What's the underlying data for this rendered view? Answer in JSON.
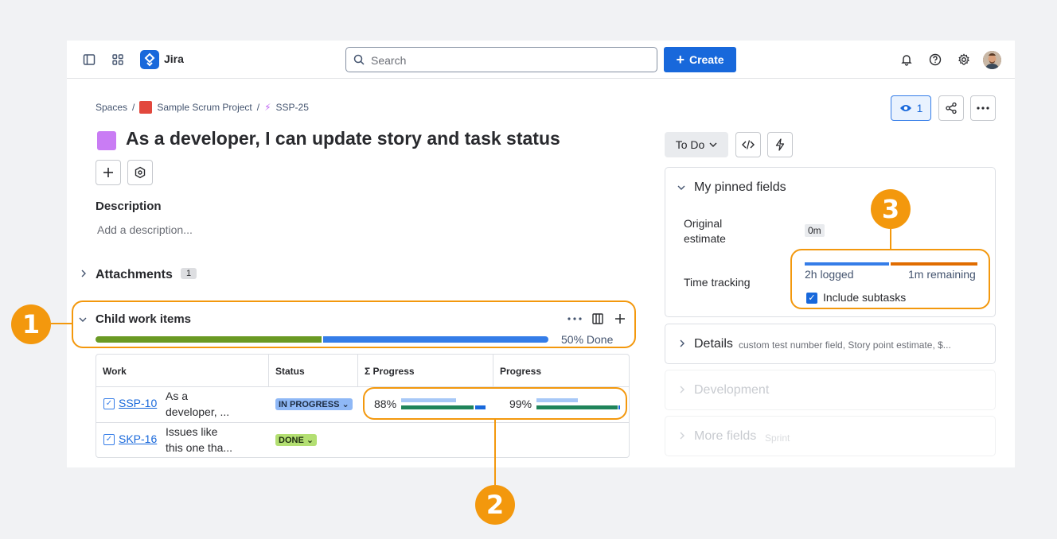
{
  "topbar": {
    "app_name": "Jira",
    "search_placeholder": "Search",
    "create_label": "Create"
  },
  "breadcrumb": {
    "spaces": "Spaces",
    "project": "Sample Scrum Project",
    "issue": "SSP-25"
  },
  "issue": {
    "title": "As a developer, I can update story and task status",
    "description_heading": "Description",
    "description_placeholder": "Add a description...",
    "attachments_heading": "Attachments",
    "attachments_count": "1",
    "child_heading": "Child work items",
    "child_progress_text": "50% Done",
    "child_progress": {
      "done_fraction": 0.5
    }
  },
  "child_table": {
    "headers": [
      "Work",
      "Status",
      "Σ Progress",
      "Progress"
    ],
    "rows": [
      {
        "key": "SSP-10",
        "summary_line1": "As a",
        "summary_line2": "developer, ...",
        "status": "IN PROGRESS",
        "sum_progress": "88%",
        "progress": "99%"
      },
      {
        "key": "SKP-16",
        "summary_line1": "Issues like",
        "summary_line2": "this one tha...",
        "status": "DONE",
        "sum_progress": "",
        "progress": ""
      }
    ]
  },
  "sidebar": {
    "watch_count": "1",
    "status_button": "To Do",
    "pinned_heading": "My pinned fields",
    "original_estimate_label_1": "Original",
    "original_estimate_label_2": "estimate",
    "original_estimate_value": "0m",
    "time_tracking_label": "Time tracking",
    "logged": "2h logged",
    "remaining": "1m remaining",
    "include_subtasks": "Include subtasks",
    "details_heading": "Details",
    "details_sub": "custom test number field, Story point estimate, $...",
    "development_heading": "Development",
    "more_fields_heading": "More fields",
    "more_fields_sub": "Sprint"
  },
  "annotations": [
    "1",
    "2",
    "3"
  ],
  "colors": {
    "accent": "#1868db",
    "annotation": "#f3980d",
    "progress_done": "#6a9a23",
    "progress_remaining": "#357de8",
    "in_progress_bg": "#8fb8f6",
    "done_bg": "#b3df72",
    "logged_bar": "#357de8",
    "remaining_bar": "#e06c00"
  }
}
